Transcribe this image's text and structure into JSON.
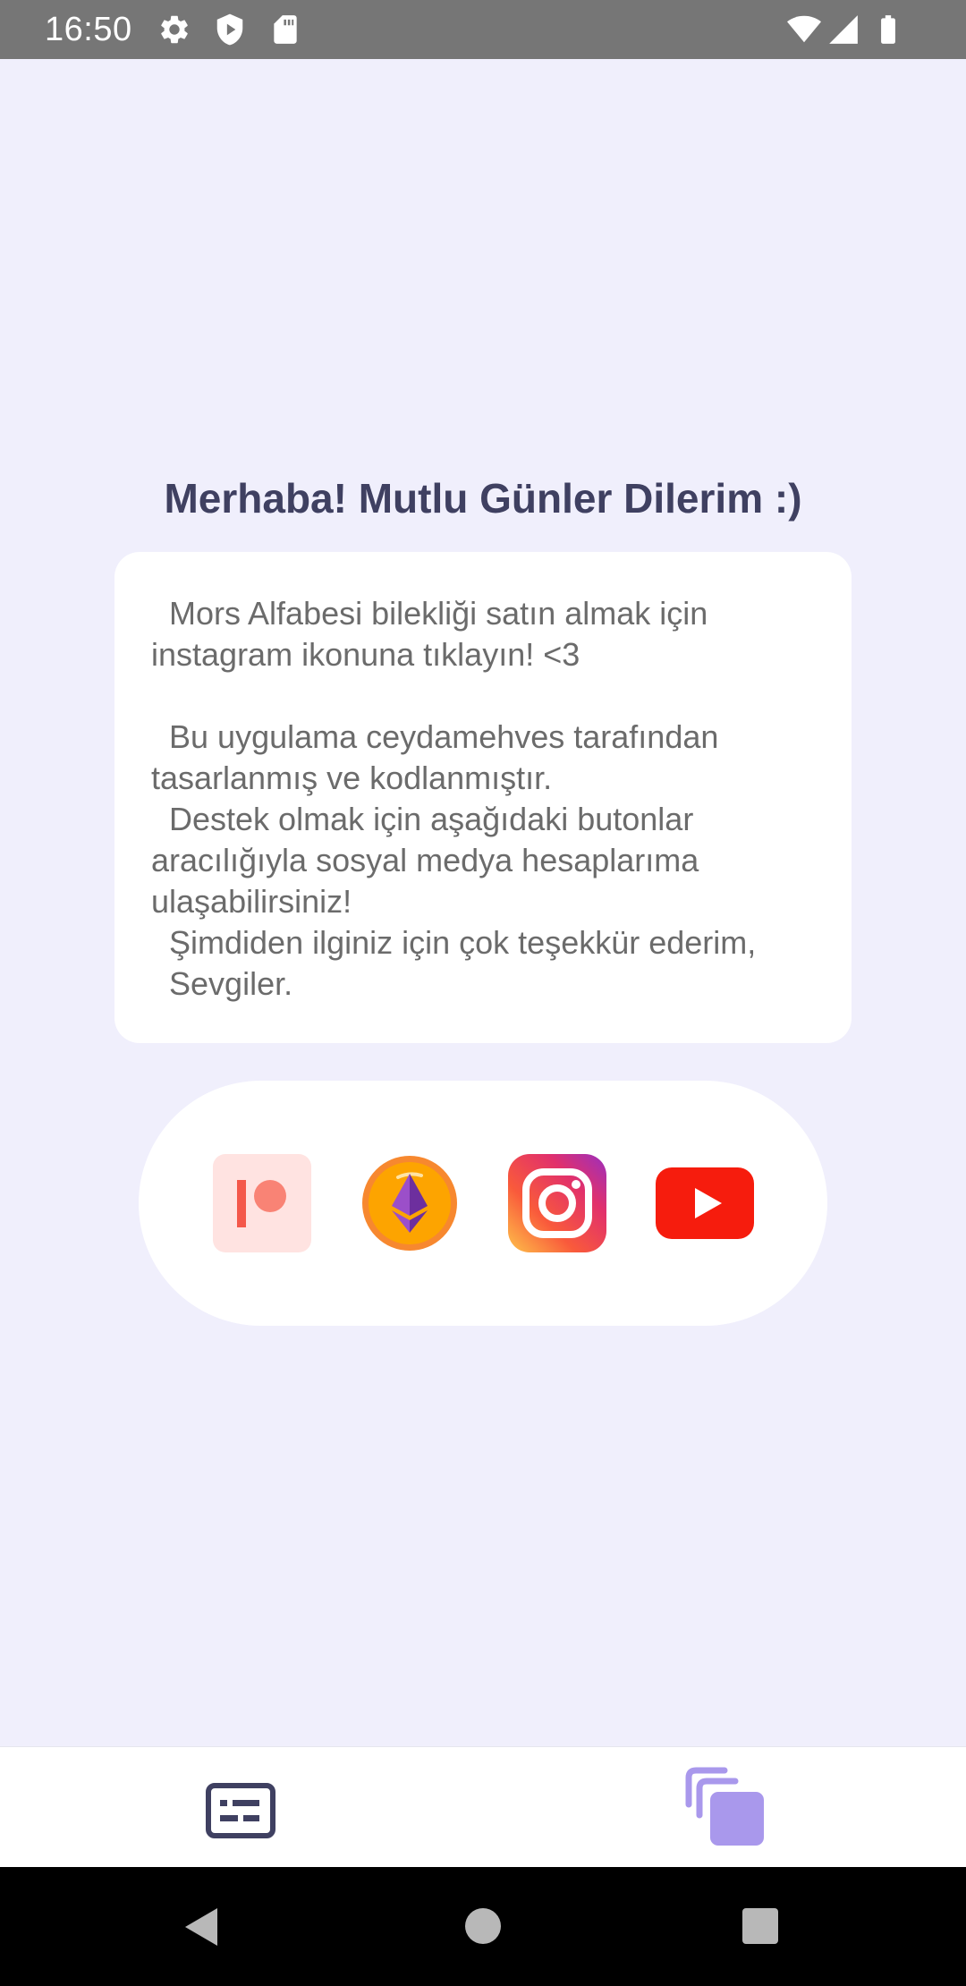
{
  "status_bar": {
    "time": "16:50",
    "icons": [
      "settings-icon",
      "shield-icon",
      "sd-card-icon",
      "wifi-icon",
      "signal-icon",
      "battery-icon"
    ]
  },
  "greeting": "Merhaba! Mutlu Günler Dilerim :)",
  "info_text": "  Mors Alfabesi bilekliği satın almak için\ninstagram ikonuna tıklayın! <3\n\n  Bu uygulama ceydamehves tarafından\ntasarlanmış ve kodlanmıştır.\n  Destek olmak için aşağıdaki butonlar\naracılığıyla sosyal medya hesaplarıma\nulaşabilirsiniz!\n  Şimdiden ilginiz için çok teşekkür ederim,\n  Sevgiler.",
  "social_buttons": [
    {
      "name": "patreon",
      "icon": "patreon-icon"
    },
    {
      "name": "ethereum",
      "icon": "ethereum-icon"
    },
    {
      "name": "instagram",
      "icon": "instagram-icon"
    },
    {
      "name": "youtube",
      "icon": "youtube-icon"
    }
  ],
  "bottom_nav": {
    "items": [
      {
        "name": "list-card",
        "icon": "list-card-icon",
        "active": false
      },
      {
        "name": "copy",
        "icon": "copy-stack-icon",
        "active": true
      }
    ]
  },
  "colors": {
    "background": "#F0EFFC",
    "title": "#3F4061",
    "body_text": "#6B6B6B",
    "accent": "#A998EC",
    "status_bar": "#767676"
  }
}
